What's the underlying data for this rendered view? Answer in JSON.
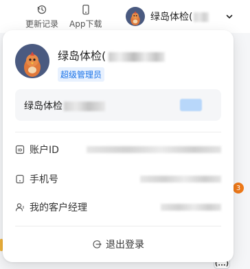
{
  "topbar": {
    "changelog_label": "更新记录",
    "app_download_label": "App下载",
    "user_name": "绿岛体检("
  },
  "profile": {
    "name": "绿岛体检(",
    "role": "超级管理员",
    "org_name": "绿岛体检"
  },
  "info": {
    "account_id_label": "账户ID",
    "phone_label": "手机号",
    "manager_label": "我的客户经理"
  },
  "logout_label": "退出登录",
  "background": {
    "badge_count": "3",
    "more_label": "(...)"
  },
  "colors": {
    "accent": "#1a73e8",
    "role_badge_bg": "#e8f1fe",
    "org_tag": "#b8d7fa",
    "notification_badge": "#f07a1a"
  },
  "icons": {
    "changelog": "history-icon",
    "app_download": "phone-icon",
    "dropdown": "chevron-down-icon",
    "account_id": "id-card-icon",
    "phone": "mobile-icon",
    "manager": "person-icon",
    "logout": "logout-icon"
  }
}
